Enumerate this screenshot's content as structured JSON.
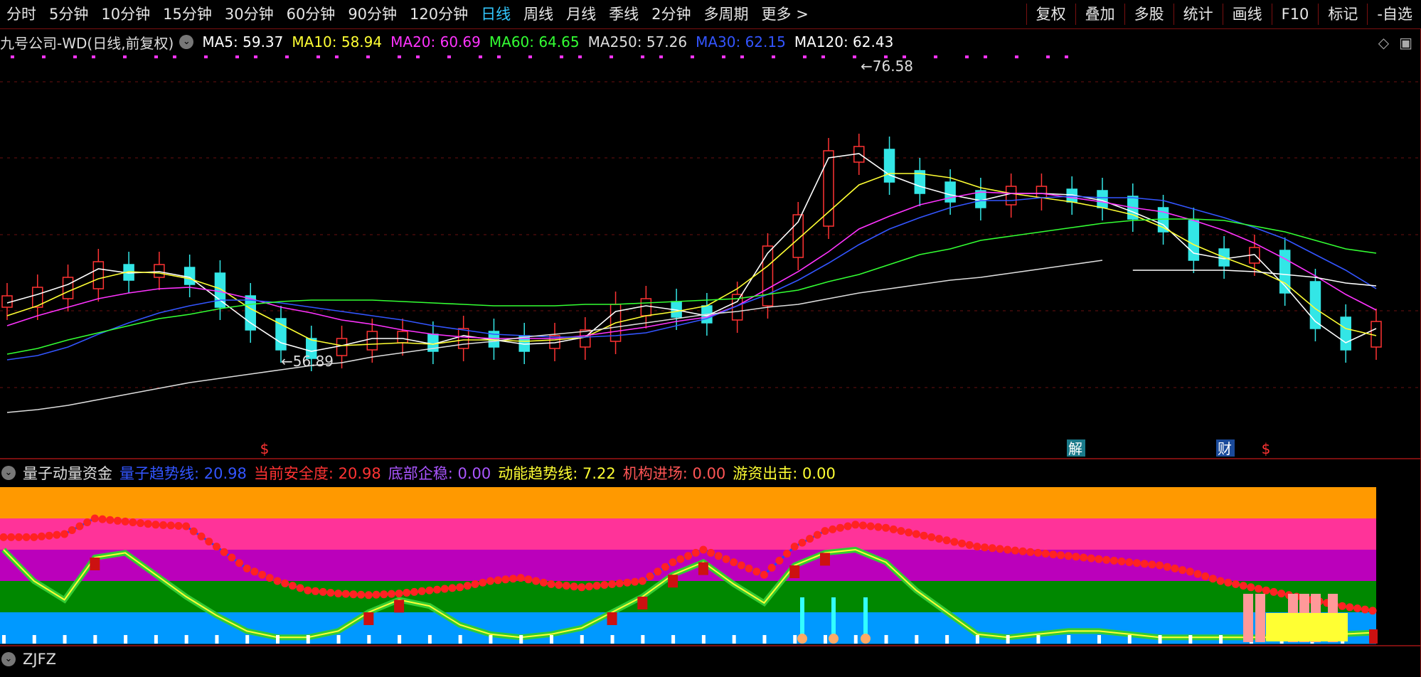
{
  "toolbar": {
    "periods": [
      "分时",
      "5分钟",
      "10分钟",
      "15分钟",
      "30分钟",
      "60分钟",
      "90分钟",
      "120分钟",
      "日线",
      "周线",
      "月线",
      "季线",
      "2分钟",
      "多周期",
      "更多 >"
    ],
    "active_period": "日线",
    "right_buttons": [
      "复权",
      "叠加",
      "多股",
      "统计",
      "画线",
      "F10",
      "标记",
      "-自选"
    ]
  },
  "main_chart": {
    "title": "九号公司-WD(日线,前复权)",
    "ma_labels": [
      {
        "text": "MA5: 59.37",
        "color": "#ffffff"
      },
      {
        "text": "MA10: 58.94",
        "color": "#ffff33"
      },
      {
        "text": "MA20: 60.69",
        "color": "#ff33ff"
      },
      {
        "text": "MA60: 64.65",
        "color": "#33ff33"
      },
      {
        "text": "MA250: 57.26",
        "color": "#dddddd"
      },
      {
        "text": "MA30: 62.15",
        "color": "#3355ff"
      },
      {
        "text": "MA120: 62.43",
        "color": "#ffffff"
      }
    ],
    "high_marker": "76.58",
    "low_marker": "56.89",
    "event_markers": [
      {
        "text": "$",
        "color": "#ff3333",
        "bg": "none"
      },
      {
        "text": "解",
        "color": "#ffffff",
        "bg": "#1a7a8a"
      },
      {
        "text": "财",
        "color": "#ffffff",
        "bg": "#1a4a9a"
      },
      {
        "text": "$",
        "color": "#ff3333",
        "bg": "none"
      }
    ]
  },
  "sub_chart_1": {
    "title": "量子动量资金",
    "indicators": [
      {
        "text": "量子趋势线: 20.98",
        "color": "#3355ff"
      },
      {
        "text": "当前安全度: 20.98",
        "color": "#ff3333"
      },
      {
        "text": "底部企稳: 0.00",
        "color": "#aa55ff"
      },
      {
        "text": "动能趋势线: 7.22",
        "color": "#ffff33"
      },
      {
        "text": "机构进场: 0.00",
        "color": "#ff5555"
      },
      {
        "text": "游资出击: 0.00",
        "color": "#ffff33"
      }
    ],
    "band_colors": [
      "#ff9900",
      "#ff3399",
      "#bb00bb",
      "#008800",
      "#0099ff"
    ]
  },
  "sub_chart_2": {
    "title": "ZJFZ"
  },
  "chart_data": [
    {
      "type": "candlestick",
      "title": "九号公司-WD(日线,前复权)",
      "ylim": [
        52,
        78
      ],
      "annotations": [
        "76.58",
        "56.89"
      ],
      "series": [
        {
          "name": "MA5",
          "values": [
            61.2,
            61.8,
            62.5,
            63.6,
            63.3,
            63.4,
            63.0,
            61.4,
            59.8,
            58.4,
            57.8,
            58.2,
            58.7,
            58.7,
            58.3,
            58.9,
            58.6,
            58.3,
            58.4,
            58.8,
            60.6,
            61.0,
            60.7,
            60.3,
            61.3,
            64.7,
            66.9,
            71.4,
            71.7,
            70.2,
            69.4,
            68.8,
            68.4,
            68.9,
            68.9,
            68.8,
            68.4,
            67.6,
            66.7,
            64.7,
            64.3,
            64.6,
            62.4,
            59.9,
            58.4,
            59.4
          ]
        },
        {
          "name": "MA10",
          "values": [
            60.3,
            61.0,
            62.0,
            62.9,
            63.4,
            63.3,
            62.9,
            62.2,
            60.8,
            59.7,
            58.6,
            58.2,
            58.3,
            58.4,
            58.3,
            58.6,
            58.6,
            58.5,
            58.6,
            58.8,
            59.8,
            60.3,
            60.6,
            61.0,
            62.2,
            63.8,
            65.7,
            67.6,
            69.5,
            70.3,
            70.3,
            70.0,
            69.3,
            68.9,
            68.6,
            68.3,
            67.9,
            67.4,
            66.5,
            65.3,
            64.4,
            63.6,
            62.6,
            60.8,
            59.4,
            58.9
          ]
        },
        {
          "name": "MA20",
          "values": [
            59.6,
            60.3,
            60.9,
            61.5,
            61.9,
            62.2,
            62.3,
            62.0,
            61.5,
            60.9,
            60.5,
            60.0,
            59.7,
            59.3,
            59.0,
            58.8,
            58.7,
            58.7,
            58.7,
            58.9,
            59.2,
            59.5,
            59.9,
            60.2,
            61.0,
            62.2,
            63.4,
            64.8,
            66.4,
            67.3,
            68.1,
            68.6,
            69.0,
            68.9,
            68.9,
            68.6,
            68.3,
            67.9,
            67.6,
            67.0,
            66.3,
            65.4,
            64.3,
            63.1,
            61.8,
            60.7
          ]
        },
        {
          "name": "MA30",
          "values": [
            57.2,
            57.5,
            58.1,
            59.0,
            59.8,
            60.5,
            61.0,
            61.4,
            61.4,
            61.2,
            60.9,
            60.6,
            60.3,
            60.0,
            59.6,
            59.3,
            59.0,
            58.9,
            58.8,
            58.8,
            58.9,
            59.1,
            59.6,
            60.1,
            61.0,
            61.8,
            62.8,
            64.0,
            65.3,
            66.4,
            67.2,
            67.9,
            68.4,
            68.4,
            68.6,
            68.7,
            68.6,
            68.6,
            68.4,
            67.8,
            67.2,
            66.5,
            65.7,
            64.6,
            63.5,
            62.2
          ]
        },
        {
          "name": "MA60",
          "values": [
            57.6,
            58.0,
            58.6,
            59.1,
            59.6,
            60.1,
            60.4,
            60.8,
            61.1,
            61.3,
            61.4,
            61.4,
            61.4,
            61.3,
            61.2,
            61.1,
            61.0,
            61.0,
            61.0,
            61.1,
            61.1,
            61.2,
            61.3,
            61.4,
            61.5,
            61.8,
            62.1,
            62.7,
            63.2,
            63.9,
            64.6,
            65.0,
            65.6,
            65.9,
            66.2,
            66.5,
            66.8,
            67.0,
            67.1,
            67.1,
            67.0,
            66.6,
            66.2,
            65.6,
            65.0,
            64.7
          ]
        },
        {
          "name": "MA120",
          "values": [
            null,
            null,
            null,
            null,
            null,
            null,
            null,
            null,
            null,
            null,
            null,
            null,
            null,
            null,
            null,
            null,
            null,
            null,
            null,
            null,
            null,
            null,
            null,
            null,
            null,
            null,
            null,
            null,
            null,
            null,
            null,
            null,
            null,
            null,
            null,
            null,
            null,
            63.5,
            63.5,
            63.5,
            63.5,
            63.4,
            63.2,
            63.0,
            62.6,
            62.4
          ]
        },
        {
          "name": "MA250",
          "values": [
            53.5,
            53.7,
            54.0,
            54.4,
            54.8,
            55.2,
            55.6,
            55.9,
            56.2,
            56.5,
            56.8,
            57.0,
            57.4,
            57.7,
            58.0,
            58.3,
            58.5,
            58.8,
            59.0,
            59.2,
            59.5,
            59.8,
            60.1,
            60.4,
            60.6,
            60.9,
            61.1,
            61.5,
            61.9,
            62.2,
            62.5,
            62.8,
            63.0,
            63.3,
            63.6,
            63.9,
            64.2,
            null,
            null,
            null,
            null,
            null,
            null,
            null,
            null,
            null
          ]
        }
      ]
    },
    {
      "type": "line",
      "title": "量子动量资金",
      "ylim": [
        0,
        100
      ],
      "series": [
        {
          "name": "量子趋势线",
          "values": [
            68,
            68,
            70,
            80,
            78,
            76,
            75,
            62,
            48,
            40,
            34,
            32,
            31,
            32,
            34,
            36,
            40,
            42,
            38,
            36,
            38,
            40,
            52,
            60,
            52,
            44,
            62,
            72,
            76,
            74,
            70,
            66,
            62,
            60,
            58,
            56,
            54,
            52,
            50,
            46,
            40,
            36,
            32,
            28,
            24,
            21
          ]
        },
        {
          "name": "动能趋势线",
          "values": [
            60,
            40,
            28,
            55,
            58,
            44,
            30,
            18,
            8,
            4,
            4,
            8,
            20,
            28,
            24,
            12,
            6,
            4,
            6,
            10,
            20,
            30,
            44,
            52,
            38,
            26,
            50,
            58,
            60,
            52,
            34,
            20,
            6,
            4,
            6,
            8,
            8,
            6,
            4,
            4,
            4,
            4,
            4,
            4,
            6,
            7
          ]
        }
      ]
    }
  ]
}
